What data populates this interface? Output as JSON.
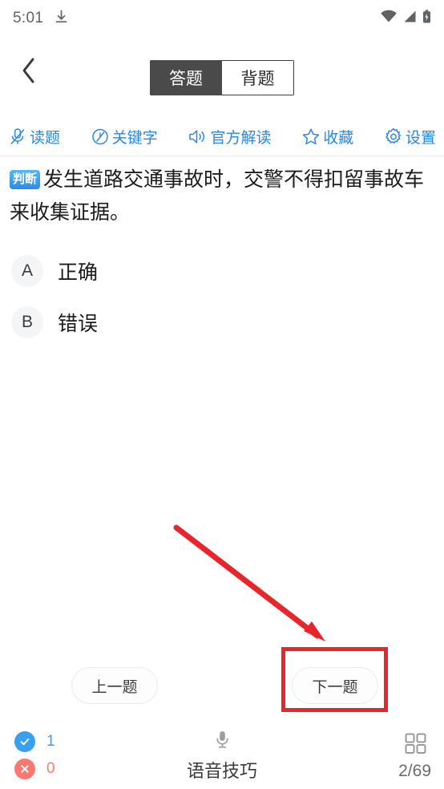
{
  "status_bar": {
    "time": "5:01",
    "icons": [
      "download-icon",
      "wifi-icon",
      "cellular-signal-icon",
      "battery-icon"
    ]
  },
  "header": {
    "back_icon": "chevron-left-icon",
    "tabs": [
      {
        "label": "答题",
        "active": true
      },
      {
        "label": "背题",
        "active": false
      }
    ]
  },
  "toolbar": {
    "items": [
      {
        "label": "读题",
        "icon": "mic-off-icon"
      },
      {
        "label": "关键字",
        "icon": "key-circle-slash-icon"
      },
      {
        "label": "官方解读",
        "icon": "speaker-icon"
      },
      {
        "label": "收藏",
        "icon": "star-outline-icon"
      },
      {
        "label": "设置",
        "icon": "gear-icon"
      }
    ],
    "accent_color": "#2b87e3"
  },
  "question": {
    "type_badge": "判断",
    "text": "发生道路交通事故时，交警不得扣留事故车来收集证据。",
    "options": [
      {
        "letter": "A",
        "text": "正确"
      },
      {
        "letter": "B",
        "text": "错误"
      }
    ]
  },
  "navigation": {
    "prev_label": "上一题",
    "next_label": "下一题"
  },
  "annotations": {
    "highlight_color": "#e8252a",
    "arrow_target": "下一题"
  },
  "bottom_bar": {
    "correct_count": "1",
    "wrong_count": "0",
    "correct_icon": "check-circle-icon",
    "wrong_icon": "x-circle-icon",
    "voice_label": "语音技巧",
    "voice_icon": "microphone-icon",
    "card_icon": "grid-icon",
    "card_count": "2/69",
    "correct_color": "#39a0f0",
    "wrong_color": "#f9796f"
  }
}
